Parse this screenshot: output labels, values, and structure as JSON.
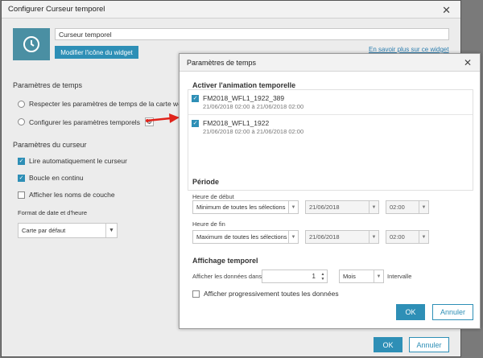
{
  "back_dialog": {
    "title": "Configurer Curseur temporel",
    "widget_name": "Curseur temporel",
    "modify_icon_label": "Modifier l'icône du widget",
    "learn_more": "En savoir plus sur ce widget",
    "time_params_title": "Paramètres de temps",
    "option_respect": "Respecter les paramètres de temps de la carte web",
    "option_configure": "Configurer les paramètres temporels",
    "slider_params_title": "Paramètres du curseur",
    "auto_play": "Lire automatiquement le curseur",
    "loop": "Boucle en continu",
    "show_layer_names": "Afficher les noms de couche",
    "date_format_title": "Format de date et d'heure",
    "date_format_value": "Carte par défaut",
    "ok": "OK",
    "cancel": "Annuler"
  },
  "front_dialog": {
    "title": "Paramètres de temps",
    "enable_animation": "Activer l'animation temporelle",
    "layers": [
      {
        "name": "FM2018_WFL1_1922_389",
        "dates": "21/06/2018 02:00 à 21/06/2018 02:00"
      },
      {
        "name": "FM2018_WFL1_1922",
        "dates": "21/06/2018 02:00 à 21/06/2018 02:00"
      }
    ],
    "period_title": "Période",
    "start_label": "Heure de début",
    "start_select": "Minimum de toutes les sélections",
    "start_date": "21/06/2018",
    "start_time": "02:00",
    "end_label": "Heure de fin",
    "end_select": "Maximum de toutes les sélections",
    "end_date": "21/06/2018",
    "end_time": "02:00",
    "display_title": "Affichage temporel",
    "display_label": "Afficher les données dans",
    "display_value": "1",
    "unit": "Mois",
    "interval": "Intervalle",
    "progressive": "Afficher progressivement toutes les données",
    "ok": "OK",
    "cancel": "Annuler"
  },
  "colors": {
    "accent": "#2e8fb6",
    "arrow": "#e0231b",
    "icon_bg": "#4a8fa3"
  }
}
